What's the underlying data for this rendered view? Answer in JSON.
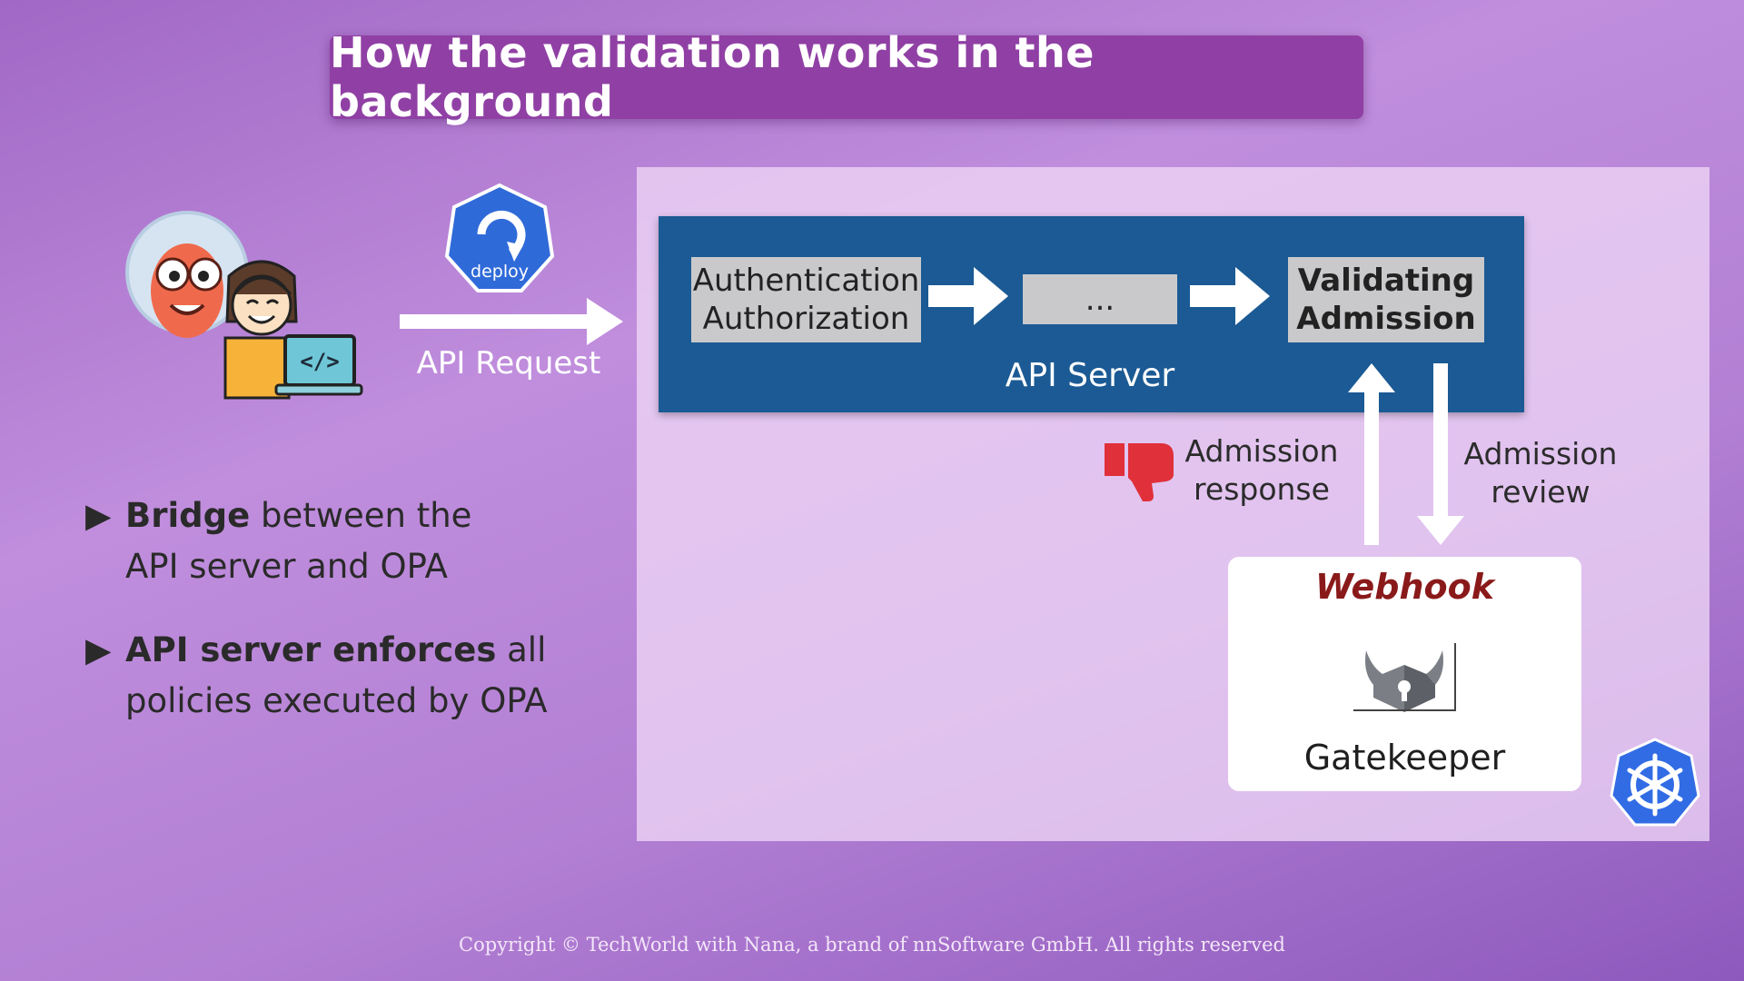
{
  "title": "How the validation works in the background",
  "deploy_icon": {
    "icon": "argo-deploy-icon",
    "label": "deploy",
    "color": "#2f6ad9"
  },
  "user_icons": {
    "robot": "argocd-robot-icon",
    "developer": "developer-laptop-icon"
  },
  "api_request_label": "API Request",
  "api_server": {
    "label": "API Server",
    "color": "#1b5a94",
    "steps": {
      "auth_line1": "Authentication",
      "auth_line2": "Authorization",
      "ellipsis": "...",
      "validating_line1": "Validating",
      "validating_line2": "Admission"
    }
  },
  "admission_response": {
    "line1": "Admission",
    "line2": "response",
    "icon": "thumbs-down-icon",
    "color": "#e0303a"
  },
  "admission_review": {
    "line1": "Admission",
    "line2": "review"
  },
  "webhook": {
    "title": "Webhook",
    "component": "Gatekeeper",
    "icon": "gatekeeper-icon"
  },
  "bullets": [
    {
      "bold": "Bridge",
      "rest_line1": " between the",
      "line2": "API server and OPA"
    },
    {
      "bold": "API server enforces",
      "rest_line1": " all",
      "line2": "policies executed by OPA"
    }
  ],
  "kubernetes_icon": {
    "icon": "kubernetes-icon",
    "color": "#326ce5"
  },
  "copyright": "Copyright © TechWorld with Nana, a brand of nnSoftware GmbH. All rights reserved"
}
